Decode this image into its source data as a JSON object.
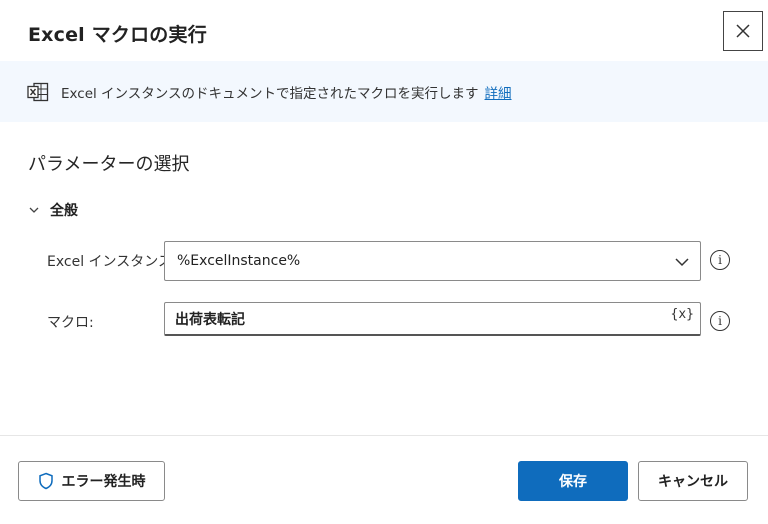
{
  "dialog": {
    "title": "Excel マクロの実行",
    "close_icon": "close-icon"
  },
  "info_bar": {
    "icon": "excel-icon",
    "text": "Excel インスタンスのドキュメントで指定されたマクロを実行します",
    "link": "詳細",
    "background": "#f3f8fe",
    "link_color": "#0f6cbd"
  },
  "parameters": {
    "section_title": "パラメーターの選択",
    "group": {
      "label": "全般",
      "icon": "chevron-down-icon"
    },
    "fields": {
      "excel_instance": {
        "label": "Excel インスタンス:",
        "value": "%ExcelInstance%",
        "icon": "chevron-down-icon"
      },
      "macro": {
        "label": "マクロ:",
        "value": "出荷表転記",
        "var_icon": "{x}"
      }
    },
    "info_icon_glyph": "i"
  },
  "footer": {
    "error_button": "エラー発生時",
    "error_icon": "shield-icon",
    "save_button": "保存",
    "cancel_button": "キャンセル",
    "primary_color": "#0f6cbd"
  }
}
